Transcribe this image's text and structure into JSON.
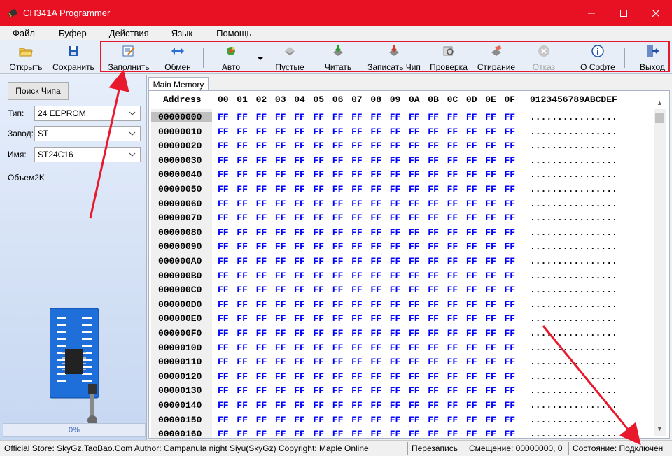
{
  "window": {
    "title": "CH341A Programmer",
    "accent_color": "#e81123",
    "controls": [
      "minimize-icon",
      "maximize-icon",
      "close-icon"
    ]
  },
  "menu": [
    "Файл",
    "Буфер",
    "Действия",
    "Язык",
    "Помощь"
  ],
  "toolbar": {
    "open": "Открыть",
    "save": "Сохранить",
    "fill": "Заполнить",
    "swap": "Обмен",
    "auto": "Авто",
    "blank": "Пустые",
    "read": "Читать",
    "write": "Записать Чип",
    "verify": "Проверка",
    "erase": "Стирание",
    "cancel": "Отказ",
    "about": "О Софте",
    "exit": "Выход"
  },
  "left_panel": {
    "search_chip": "Поиск Чипа",
    "type_label": "Тип:",
    "type_value": "24 EEPROM",
    "maker_label": "Завод:",
    "maker_value": "ST",
    "name_label": "Имя:",
    "name_value": "ST24C16",
    "volume": "Объем2K",
    "progress_text": "0%",
    "progress_fraction": 0
  },
  "hex": {
    "tab": "Main Memory",
    "address_header": "Address",
    "columns": [
      "00",
      "01",
      "02",
      "03",
      "04",
      "05",
      "06",
      "07",
      "08",
      "09",
      "0A",
      "0B",
      "0C",
      "0D",
      "0E",
      "0F"
    ],
    "ascii_header": "0123456789ABCDEF",
    "rows": [
      "00000000",
      "00000010",
      "00000020",
      "00000030",
      "00000040",
      "00000050",
      "00000060",
      "00000070",
      "00000080",
      "00000090",
      "000000A0",
      "000000B0",
      "000000C0",
      "000000D0",
      "000000E0",
      "000000F0",
      "00000100",
      "00000110",
      "00000120",
      "00000130",
      "00000140",
      "00000150",
      "00000160"
    ],
    "byte_value": "FF",
    "ascii_value": "................",
    "byte_color": "#0000ff"
  },
  "status": {
    "info": "Official Store: SkyGz.TaoBao.Com Author: Campanula night Siyu(SkyGz) Copyright: Maple Online",
    "mode": "Перезапись",
    "offset": "Смещение: 00000000, 0",
    "state": "Состояние: Подключен"
  }
}
